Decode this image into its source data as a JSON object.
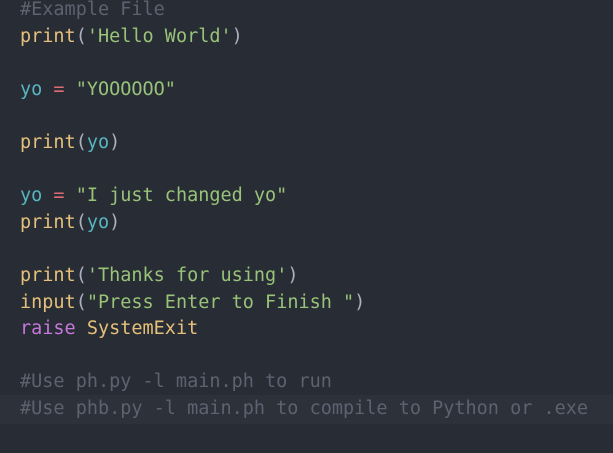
{
  "editor": {
    "lines": [
      [
        {
          "t": "comment",
          "v": "#Example File"
        }
      ],
      [
        {
          "t": "func",
          "v": "print"
        },
        {
          "t": "punc",
          "v": "("
        },
        {
          "t": "str",
          "v": "'Hello World'"
        },
        {
          "t": "punc",
          "v": ")"
        }
      ],
      [],
      [
        {
          "t": "var",
          "v": "yo"
        },
        {
          "t": "punc",
          "v": " "
        },
        {
          "t": "op",
          "v": "="
        },
        {
          "t": "punc",
          "v": " "
        },
        {
          "t": "str",
          "v": "\"YOOOOOO\""
        }
      ],
      [],
      [
        {
          "t": "func",
          "v": "print"
        },
        {
          "t": "punc",
          "v": "("
        },
        {
          "t": "var",
          "v": "yo"
        },
        {
          "t": "punc",
          "v": ")"
        }
      ],
      [],
      [
        {
          "t": "var",
          "v": "yo"
        },
        {
          "t": "punc",
          "v": " "
        },
        {
          "t": "op",
          "v": "="
        },
        {
          "t": "punc",
          "v": " "
        },
        {
          "t": "str",
          "v": "\"I just changed yo\""
        }
      ],
      [
        {
          "t": "func",
          "v": "print"
        },
        {
          "t": "punc",
          "v": "("
        },
        {
          "t": "var",
          "v": "yo"
        },
        {
          "t": "punc",
          "v": ")"
        }
      ],
      [],
      [
        {
          "t": "func",
          "v": "print"
        },
        {
          "t": "punc",
          "v": "("
        },
        {
          "t": "str",
          "v": "'Thanks for using'"
        },
        {
          "t": "punc",
          "v": ")"
        }
      ],
      [
        {
          "t": "func",
          "v": "input"
        },
        {
          "t": "punc",
          "v": "("
        },
        {
          "t": "str",
          "v": "\"Press Enter to Finish \""
        },
        {
          "t": "punc",
          "v": ")"
        }
      ],
      [
        {
          "t": "kw",
          "v": "raise"
        },
        {
          "t": "punc",
          "v": " "
        },
        {
          "t": "cls",
          "v": "SystemExit"
        }
      ],
      [],
      [
        {
          "t": "comment",
          "v": "#Use ph.py -l main.ph to run"
        }
      ],
      [
        {
          "t": "comment",
          "v": "#Use phb.py -l main.ph to compile to Python or .exe"
        }
      ]
    ],
    "highlighted_line": 15
  },
  "colors": {
    "background": "#282c34",
    "comment": "#5c6370",
    "function": "#e5c07b",
    "string": "#98c379",
    "variable": "#56b6c2",
    "operator": "#e06c75",
    "keyword": "#c678dd",
    "punctuation": "#abb2bf"
  }
}
